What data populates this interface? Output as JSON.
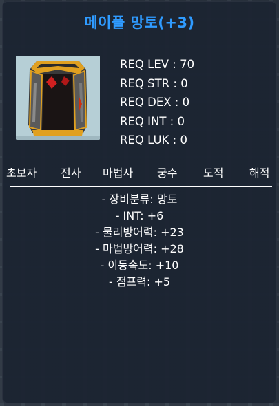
{
  "item": {
    "name": "메이플 망토(+3)",
    "icon": "cape-icon"
  },
  "requirements": [
    "REQ LEV : 70",
    "REQ STR : 0",
    "REQ DEX : 0",
    "REQ INT : 0",
    "REQ LUK : 0"
  ],
  "jobs": [
    "초보자",
    "전사",
    "마법사",
    "궁수",
    "도적",
    "해적"
  ],
  "stats": [
    "- 장비분류: 망토",
    "- INT: +6",
    "- 물리방어력: +23",
    "- 마법방어력: +28",
    "- 이동속도: +10",
    "- 점프력: +5"
  ],
  "colors": {
    "title": "#2f9bff",
    "text": "#ffffff",
    "panel": "#1c2432",
    "icon_bg": "#b6cfd6"
  }
}
